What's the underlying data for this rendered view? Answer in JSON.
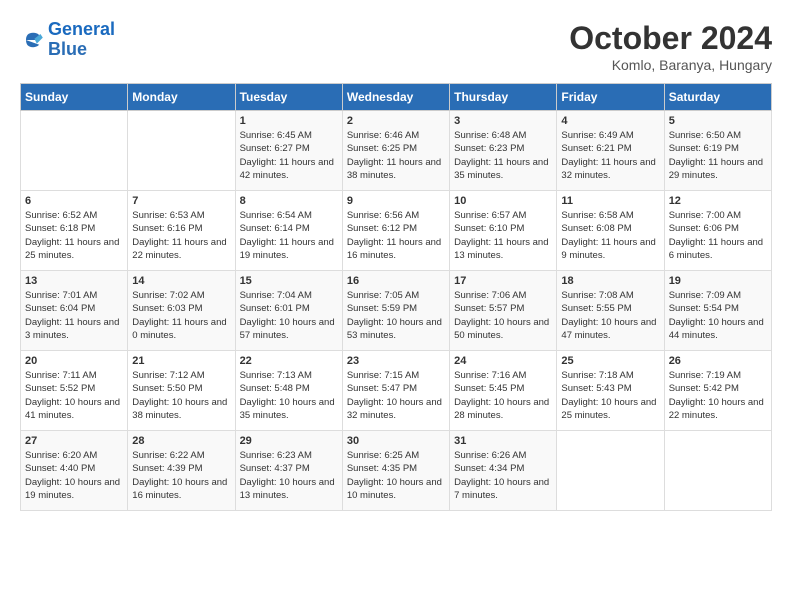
{
  "logo": {
    "line1": "General",
    "line2": "Blue"
  },
  "title": "October 2024",
  "location": "Komlo, Baranya, Hungary",
  "days_header": [
    "Sunday",
    "Monday",
    "Tuesday",
    "Wednesday",
    "Thursday",
    "Friday",
    "Saturday"
  ],
  "weeks": [
    [
      {
        "day": "",
        "sunrise": "",
        "sunset": "",
        "daylight": ""
      },
      {
        "day": "",
        "sunrise": "",
        "sunset": "",
        "daylight": ""
      },
      {
        "day": "1",
        "sunrise": "Sunrise: 6:45 AM",
        "sunset": "Sunset: 6:27 PM",
        "daylight": "Daylight: 11 hours and 42 minutes."
      },
      {
        "day": "2",
        "sunrise": "Sunrise: 6:46 AM",
        "sunset": "Sunset: 6:25 PM",
        "daylight": "Daylight: 11 hours and 38 minutes."
      },
      {
        "day": "3",
        "sunrise": "Sunrise: 6:48 AM",
        "sunset": "Sunset: 6:23 PM",
        "daylight": "Daylight: 11 hours and 35 minutes."
      },
      {
        "day": "4",
        "sunrise": "Sunrise: 6:49 AM",
        "sunset": "Sunset: 6:21 PM",
        "daylight": "Daylight: 11 hours and 32 minutes."
      },
      {
        "day": "5",
        "sunrise": "Sunrise: 6:50 AM",
        "sunset": "Sunset: 6:19 PM",
        "daylight": "Daylight: 11 hours and 29 minutes."
      }
    ],
    [
      {
        "day": "6",
        "sunrise": "Sunrise: 6:52 AM",
        "sunset": "Sunset: 6:18 PM",
        "daylight": "Daylight: 11 hours and 25 minutes."
      },
      {
        "day": "7",
        "sunrise": "Sunrise: 6:53 AM",
        "sunset": "Sunset: 6:16 PM",
        "daylight": "Daylight: 11 hours and 22 minutes."
      },
      {
        "day": "8",
        "sunrise": "Sunrise: 6:54 AM",
        "sunset": "Sunset: 6:14 PM",
        "daylight": "Daylight: 11 hours and 19 minutes."
      },
      {
        "day": "9",
        "sunrise": "Sunrise: 6:56 AM",
        "sunset": "Sunset: 6:12 PM",
        "daylight": "Daylight: 11 hours and 16 minutes."
      },
      {
        "day": "10",
        "sunrise": "Sunrise: 6:57 AM",
        "sunset": "Sunset: 6:10 PM",
        "daylight": "Daylight: 11 hours and 13 minutes."
      },
      {
        "day": "11",
        "sunrise": "Sunrise: 6:58 AM",
        "sunset": "Sunset: 6:08 PM",
        "daylight": "Daylight: 11 hours and 9 minutes."
      },
      {
        "day": "12",
        "sunrise": "Sunrise: 7:00 AM",
        "sunset": "Sunset: 6:06 PM",
        "daylight": "Daylight: 11 hours and 6 minutes."
      }
    ],
    [
      {
        "day": "13",
        "sunrise": "Sunrise: 7:01 AM",
        "sunset": "Sunset: 6:04 PM",
        "daylight": "Daylight: 11 hours and 3 minutes."
      },
      {
        "day": "14",
        "sunrise": "Sunrise: 7:02 AM",
        "sunset": "Sunset: 6:03 PM",
        "daylight": "Daylight: 11 hours and 0 minutes."
      },
      {
        "day": "15",
        "sunrise": "Sunrise: 7:04 AM",
        "sunset": "Sunset: 6:01 PM",
        "daylight": "Daylight: 10 hours and 57 minutes."
      },
      {
        "day": "16",
        "sunrise": "Sunrise: 7:05 AM",
        "sunset": "Sunset: 5:59 PM",
        "daylight": "Daylight: 10 hours and 53 minutes."
      },
      {
        "day": "17",
        "sunrise": "Sunrise: 7:06 AM",
        "sunset": "Sunset: 5:57 PM",
        "daylight": "Daylight: 10 hours and 50 minutes."
      },
      {
        "day": "18",
        "sunrise": "Sunrise: 7:08 AM",
        "sunset": "Sunset: 5:55 PM",
        "daylight": "Daylight: 10 hours and 47 minutes."
      },
      {
        "day": "19",
        "sunrise": "Sunrise: 7:09 AM",
        "sunset": "Sunset: 5:54 PM",
        "daylight": "Daylight: 10 hours and 44 minutes."
      }
    ],
    [
      {
        "day": "20",
        "sunrise": "Sunrise: 7:11 AM",
        "sunset": "Sunset: 5:52 PM",
        "daylight": "Daylight: 10 hours and 41 minutes."
      },
      {
        "day": "21",
        "sunrise": "Sunrise: 7:12 AM",
        "sunset": "Sunset: 5:50 PM",
        "daylight": "Daylight: 10 hours and 38 minutes."
      },
      {
        "day": "22",
        "sunrise": "Sunrise: 7:13 AM",
        "sunset": "Sunset: 5:48 PM",
        "daylight": "Daylight: 10 hours and 35 minutes."
      },
      {
        "day": "23",
        "sunrise": "Sunrise: 7:15 AM",
        "sunset": "Sunset: 5:47 PM",
        "daylight": "Daylight: 10 hours and 32 minutes."
      },
      {
        "day": "24",
        "sunrise": "Sunrise: 7:16 AM",
        "sunset": "Sunset: 5:45 PM",
        "daylight": "Daylight: 10 hours and 28 minutes."
      },
      {
        "day": "25",
        "sunrise": "Sunrise: 7:18 AM",
        "sunset": "Sunset: 5:43 PM",
        "daylight": "Daylight: 10 hours and 25 minutes."
      },
      {
        "day": "26",
        "sunrise": "Sunrise: 7:19 AM",
        "sunset": "Sunset: 5:42 PM",
        "daylight": "Daylight: 10 hours and 22 minutes."
      }
    ],
    [
      {
        "day": "27",
        "sunrise": "Sunrise: 6:20 AM",
        "sunset": "Sunset: 4:40 PM",
        "daylight": "Daylight: 10 hours and 19 minutes."
      },
      {
        "day": "28",
        "sunrise": "Sunrise: 6:22 AM",
        "sunset": "Sunset: 4:39 PM",
        "daylight": "Daylight: 10 hours and 16 minutes."
      },
      {
        "day": "29",
        "sunrise": "Sunrise: 6:23 AM",
        "sunset": "Sunset: 4:37 PM",
        "daylight": "Daylight: 10 hours and 13 minutes."
      },
      {
        "day": "30",
        "sunrise": "Sunrise: 6:25 AM",
        "sunset": "Sunset: 4:35 PM",
        "daylight": "Daylight: 10 hours and 10 minutes."
      },
      {
        "day": "31",
        "sunrise": "Sunrise: 6:26 AM",
        "sunset": "Sunset: 4:34 PM",
        "daylight": "Daylight: 10 hours and 7 minutes."
      },
      {
        "day": "",
        "sunrise": "",
        "sunset": "",
        "daylight": ""
      },
      {
        "day": "",
        "sunrise": "",
        "sunset": "",
        "daylight": ""
      }
    ]
  ]
}
